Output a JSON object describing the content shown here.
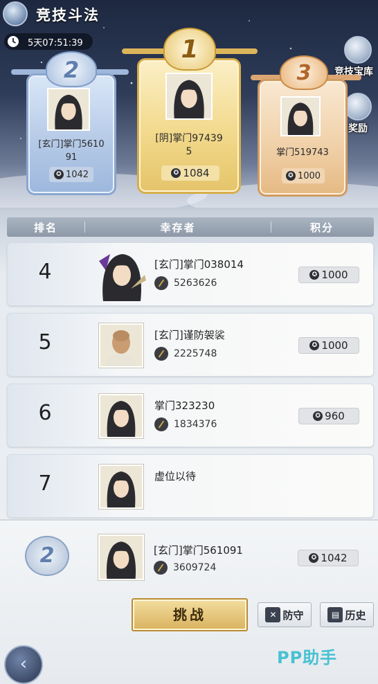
{
  "header": {
    "title": "竞技斗法",
    "timer": "5天07:51:39",
    "side_buttons": [
      {
        "label": "竞技宝库",
        "icon": "treasure-bag-icon"
      },
      {
        "label": "奖励",
        "icon": "reward-chest-icon"
      }
    ]
  },
  "podium": [
    {
      "rank_badge": "2",
      "name": "[玄门]掌门561091",
      "score": "1042",
      "tier": "silver"
    },
    {
      "rank_badge": "1",
      "name": "[阴]掌门974395",
      "score": "1084",
      "tier": "gold"
    },
    {
      "rank_badge": "3",
      "name": "掌门519743",
      "score": "1000",
      "tier": "bronze"
    }
  ],
  "table": {
    "headers": [
      "排名",
      "幸存者",
      "积分"
    ],
    "rows": [
      {
        "rank": "4",
        "name": "[玄门]掌门038014",
        "power": "5263626",
        "score": "1000",
        "avatar": "long-hair-portrait"
      },
      {
        "rank": "5",
        "name": "[玄门]谨防袈裟",
        "power": "2225748",
        "score": "1000",
        "avatar": "monk-portrait"
      },
      {
        "rank": "6",
        "name": "掌门323230",
        "power": "1834376",
        "score": "960",
        "avatar": "long-hair-portrait"
      },
      {
        "rank": "7",
        "name": "虚位以待",
        "power": "",
        "score": "",
        "avatar": "long-hair-portrait"
      }
    ]
  },
  "self": {
    "rank_badge": "2",
    "name": "[玄门]掌门561091",
    "power": "3609724",
    "score": "1042"
  },
  "actions": {
    "challenge": "挑战",
    "defend": "防守",
    "history": "历史"
  },
  "watermark": "PP助手",
  "colors": {
    "gold": "#e5c46a",
    "silver": "#9db7dd",
    "bronze": "#e5b983",
    "header_bar": "#8e99a8",
    "watermark": "#48c1d2"
  }
}
